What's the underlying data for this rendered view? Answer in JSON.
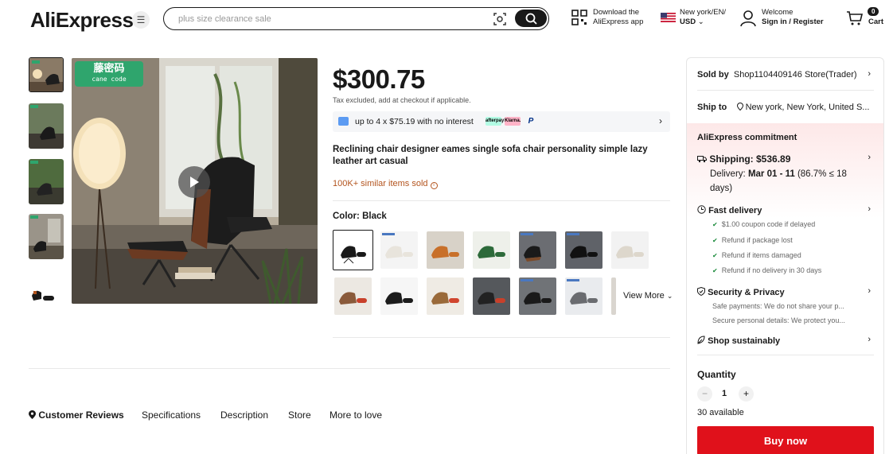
{
  "header": {
    "logo": "AliExpress",
    "search_placeholder": "plus size clearance sale",
    "app_line1": "Download the",
    "app_line2": "AliExpress app",
    "lang_line1": "New york/EN/",
    "lang_line2": "USD",
    "acct_line1": "Welcome",
    "acct_line2": "Sign in / Register",
    "cart_count": "0",
    "cart_label": "Cart"
  },
  "product": {
    "price": "$300.75",
    "tax_note": "Tax excluded, add at checkout if applicable.",
    "installment": "up to 4 x $75.19 with no interest",
    "pay_methods": [
      "afterpay",
      "Klarna.",
      "P"
    ],
    "title": "Reclining chair designer eames single sofa chair personality simple lazy leather art casual",
    "sold": "100K+ similar items sold",
    "color_label": "Color: ",
    "color_value": "Black",
    "view_more": "View More",
    "brand_cn": "藤密码",
    "brand_en": "cane code"
  },
  "tabs": [
    "Customer Reviews",
    "Specifications",
    "Description",
    "Store",
    "More to love"
  ],
  "panel": {
    "sold_by_label": "Sold by",
    "sold_by_value": "Shop1104409146 Store(Trader)",
    "ship_to_label": "Ship to",
    "ship_to_value": "New york, New York, United S...",
    "commitment": "AliExpress commitment",
    "shipping": "Shipping: $536.89",
    "delivery_label": "Delivery: ",
    "delivery_date": "Mar 01 - 11",
    "delivery_rate": " (86.7% ≤ 18",
    "delivery_rate2": "days)",
    "fast_delivery": "Fast delivery",
    "fast_items": [
      "$1.00 coupon code if delayed",
      "Refund if package lost",
      "Refund if items damaged",
      "Refund if no delivery in 30 days"
    ],
    "security": "Security & Privacy",
    "security_items": [
      "Safe payments: We do not share your p...",
      "Secure personal details: We protect you..."
    ],
    "sustain": "Shop sustainably",
    "qty_label": "Quantity",
    "qty_value": "1",
    "available": "30 available",
    "buy_now": "Buy now"
  }
}
